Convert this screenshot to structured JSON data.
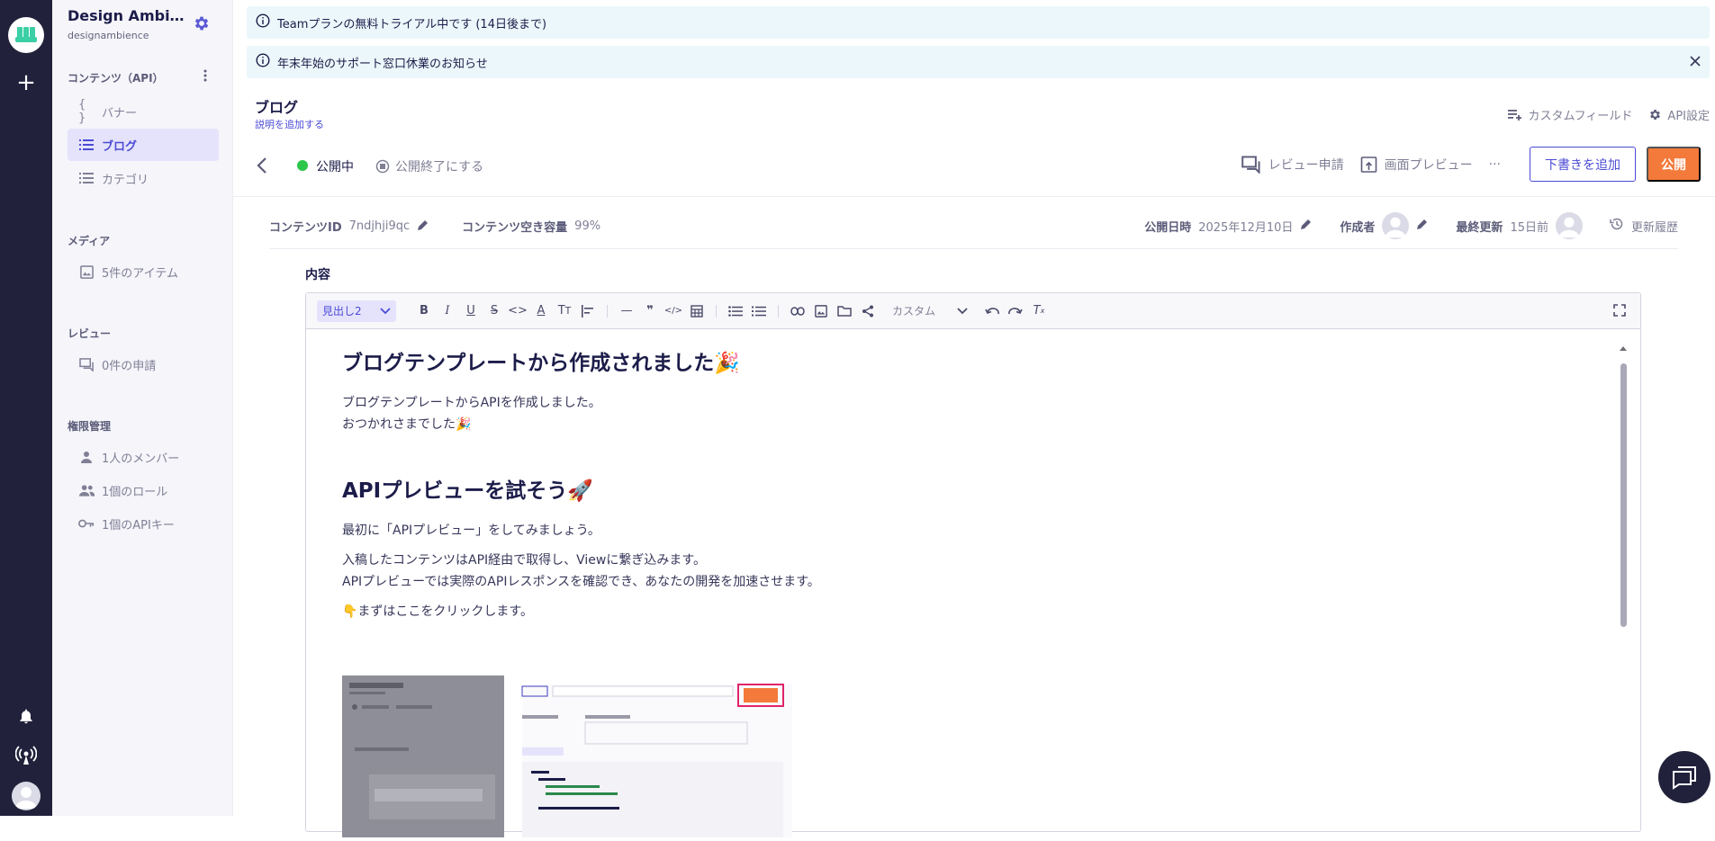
{
  "sidebar": {
    "service_name": "Design Ambien…",
    "service_id": "designambience",
    "content_section": "コンテンツ（API）",
    "content_items": [
      {
        "label": "バナー",
        "icon": "braces-icon"
      },
      {
        "label": "ブログ",
        "icon": "list-icon"
      },
      {
        "label": "カテゴリ",
        "icon": "list-icon"
      }
    ],
    "media_section": "メディア",
    "media_item": "5件のアイテム",
    "review_section": "レビュー",
    "review_item": "0件の申請",
    "perm_section": "権限管理",
    "perm_items": [
      "1人のメンバー",
      "1個のロール",
      "1個のAPIキー"
    ]
  },
  "banners": {
    "trial": "Teamプランの無料トライアル中です (14日後まで)",
    "notice": "年末年始のサポート窓口休業のお知らせ"
  },
  "header": {
    "title": "ブログ",
    "description_link": "説明を追加する",
    "custom_field": "カスタムフィールド",
    "api_settings": "API設定"
  },
  "status_bar": {
    "status": "公開中",
    "unpublish": "公開終了にする",
    "review_request": "レビュー申請",
    "preview": "画面プレビュー",
    "more": "···",
    "add_draft": "下書きを追加",
    "publish": "公開"
  },
  "meta": {
    "content_id_label": "コンテンツID",
    "content_id": "7ndjhji9qc",
    "capacity_label": "コンテンツ空き容量",
    "capacity": "99%",
    "published_label": "公開日時",
    "published": "2025年12月10日",
    "author_label": "作成者",
    "updated_label": "最終更新",
    "updated": "15日前",
    "history": "更新履歴"
  },
  "editor": {
    "field_label": "内容",
    "heading_select": "見出し2",
    "custom_select": "カスタム",
    "h1": "ブログテンプレートから作成されました🎉",
    "p1a": "ブログテンプレートからAPIを作成しました。",
    "p1b": "おつかれさまでした🎉",
    "h2": "APIプレビューを試そう🚀",
    "p2": "最初に「APIプレビュー」をしてみましょう。",
    "p3a": "入稿したコンテンツはAPI経由で取得し、Viewに繋ぎ込みます。",
    "p3b": "APIプレビューでは実際のAPIレスポンスを確認でき、あなたの開発を加速させます。",
    "p4": "👇まずはここをクリックします。"
  },
  "colors": {
    "rail": "#21213b",
    "accent": "#4b4bd6",
    "publish": "#f37a3a",
    "status": "#2dc64a",
    "banner": "#ebf7fa"
  }
}
